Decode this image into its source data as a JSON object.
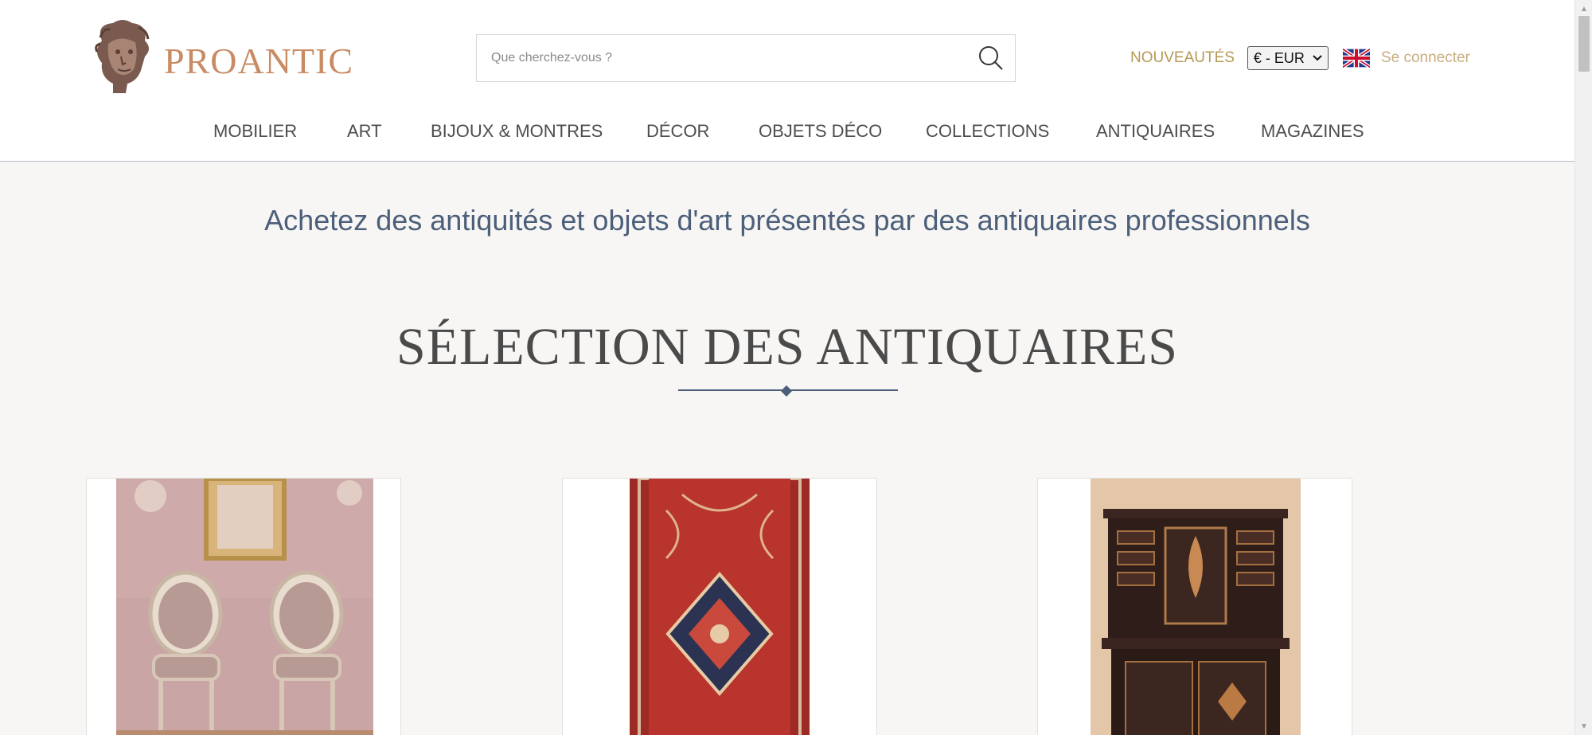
{
  "brand": {
    "name": "PROANTIC"
  },
  "search": {
    "placeholder": "Que cherchez-vous ?"
  },
  "header_links": {
    "new_label": "NOUVEAUTÉS",
    "currency": "€ - EUR",
    "language_icon": "uk-flag-icon",
    "login_label": "Se connecter"
  },
  "nav": {
    "items": [
      {
        "label": "MOBILIER"
      },
      {
        "label": "ART"
      },
      {
        "label": "BIJOUX & MONTRES"
      },
      {
        "label": "DÉCOR"
      },
      {
        "label": "OBJETS DÉCO"
      },
      {
        "label": "COLLECTIONS"
      },
      {
        "label": "ANTIQUAIRES"
      },
      {
        "label": "MAGAZINES"
      }
    ]
  },
  "tagline": "Achetez des antiquités et objets d'art présentés par des antiquaires professionnels",
  "section": {
    "title": "SÉLECTION DES ANTIQUAIRES"
  },
  "products": [
    {
      "image": "pair-of-chairs"
    },
    {
      "image": "red-persian-rug"
    },
    {
      "image": "inlaid-cabinet"
    }
  ],
  "colors": {
    "brand": "#c88b63",
    "accent_gold": "#b59a55",
    "tagline_blue": "#4c5f7a",
    "background": "#f7f6f4"
  }
}
